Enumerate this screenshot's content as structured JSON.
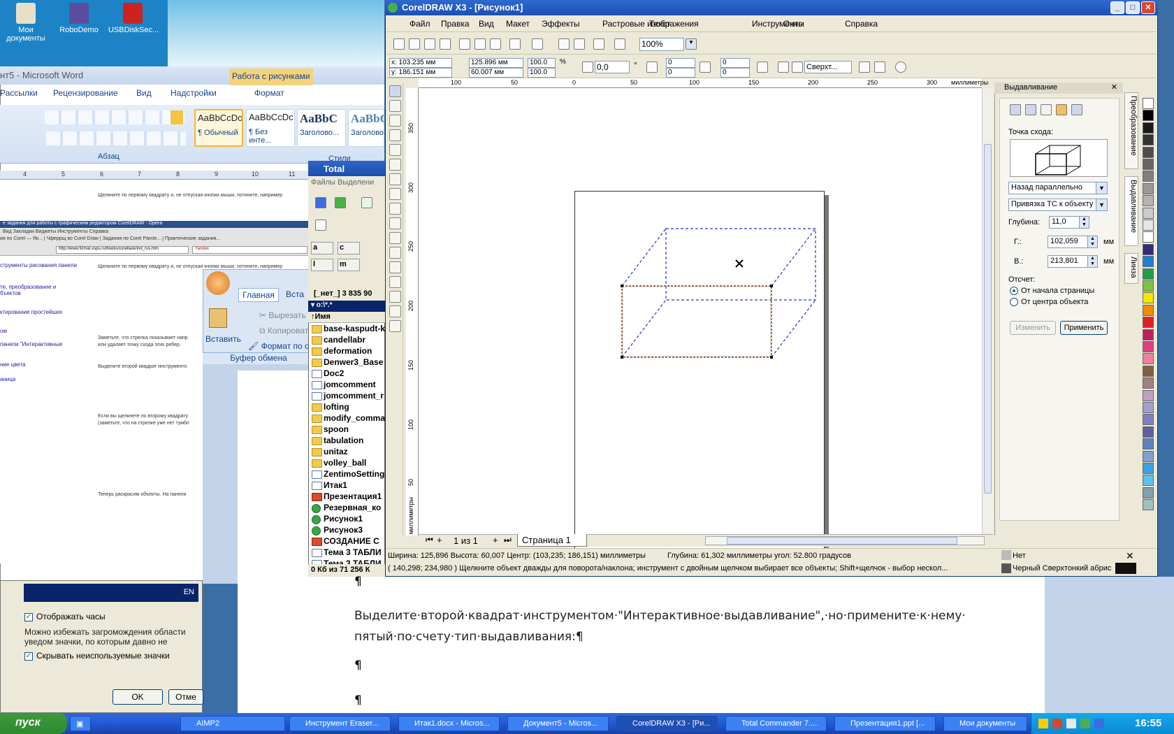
{
  "desktop": {
    "icons": [
      {
        "label": "Мои документы"
      },
      {
        "label": "RoboDemo"
      },
      {
        "label": "USBDiskSec..."
      }
    ]
  },
  "word": {
    "title": "нт5 - Microsoft Word",
    "context_tab": "Работа с рисунками",
    "tabs": [
      "Рассылки",
      "Рецензирование",
      "Вид",
      "Надстройки",
      "Формат"
    ],
    "groups": [
      "Абзац",
      "Стили"
    ],
    "styles": [
      {
        "preview": "AaBbCcDc",
        "name": "¶ Обычный"
      },
      {
        "preview": "AaBbCcDc",
        "name": "¶ Без инте..."
      },
      {
        "preview": "AaBbC",
        "name": "Заголово..."
      },
      {
        "preview": "AaBbC",
        "name": "Заголово"
      }
    ],
    "ruler_marks": [
      "4",
      "5",
      "6",
      "7",
      "8",
      "9",
      "10",
      "11"
    ],
    "inner_lines": [
      "Щелкните по первому квадрату и, не отпуская кнопки мыши, потяните, например",
      "Щелкните по первому квадрату и, не отпуская кнопки мыши, потяните, например",
      "Заметьте, что стрелка показывает напр",
      "или удаляет точку схода этих ребер.",
      "Выделите второй квадрат инструменто",
      "Если вы щелкнете по второму квадрату",
      "(заметьте, что на стрелке уже нет тумбл",
      "Теперь раскрасим объекты. На панели"
    ],
    "side_links": [
      "струменты рисования панели",
      "те, преобразование и",
      "бъектов",
      "ктирование простейших",
      "ом",
      "панели \"Интерактивные",
      "ние цвета",
      "аница"
    ],
    "opera_title": "е задания для работы с графическим редактором CorelDRAW - Opera",
    "opera_menu": [
      "Вид",
      "Закладки",
      "Виджеты",
      "Инструменты",
      "Справка"
    ],
    "opera_tabs": [
      "ия по Corel — Як...",
      "Чферрщ во Corel Draw",
      "Задания по Corel Painte...",
      "Практические задания..."
    ],
    "opera_url": "http://www.fizmat.vspu.ru/books/coreltask/ind_rus.htm",
    "opera_search": "Yandex"
  },
  "word2": {
    "tabs": [
      "Главная",
      "Вста"
    ],
    "cut": "Вырезать",
    "copy": "Копировать",
    "format": "Формат по об",
    "paste": "Вставить",
    "group": "Буфер обмена"
  },
  "dialog": {
    "lang": "EN",
    "show_clock": "Отображать часы",
    "info": "Можно избежать загромождения области уведом значки, по которым давно не выполнялись щелчи",
    "hide_unused": "Скрывать неиспользуемые значки",
    "ok": "OK",
    "cancel": "Отме"
  },
  "tc": {
    "title": "Total Comman",
    "menu": "Файлы  Выделени",
    "drives": [
      "a",
      "c",
      "l",
      "m"
    ],
    "info": "[_нет_]  3 835 90",
    "path": "▾ o:\\*.*",
    "header": "↑Имя",
    "files": [
      {
        "name": "base-kaspudt-k",
        "t": "d"
      },
      {
        "name": "candellabr",
        "t": "d"
      },
      {
        "name": "deformation",
        "t": "d"
      },
      {
        "name": "Denwer3_Base",
        "t": "d"
      },
      {
        "name": "Doc2",
        "t": "f"
      },
      {
        "name": "jomcomment",
        "t": "f"
      },
      {
        "name": "jomcomment_r",
        "t": "f"
      },
      {
        "name": "lofting",
        "t": "d"
      },
      {
        "name": "modify_comma",
        "t": "d"
      },
      {
        "name": "spoon",
        "t": "d"
      },
      {
        "name": "tabulation",
        "t": "d"
      },
      {
        "name": "unitaz",
        "t": "d"
      },
      {
        "name": "volley_ball",
        "t": "d"
      },
      {
        "name": "ZentimoSetting",
        "t": "f"
      },
      {
        "name": "Итак1",
        "t": "f"
      },
      {
        "name": "Презентация1",
        "t": "r"
      },
      {
        "name": "Резервная_ко",
        "t": "c"
      },
      {
        "name": "Рисунок1",
        "t": "c"
      },
      {
        "name": "Рисунок3",
        "t": "c"
      },
      {
        "name": "СОЗДАНИЕ С",
        "t": "r"
      },
      {
        "name": "Тема 3 ТАБЛИ",
        "t": "f"
      },
      {
        "name": "Тема 3 ТАБЛИ",
        "t": "f"
      }
    ],
    "footer": "0 Кб из 71 256 К"
  },
  "doc2": {
    "p1": "¶",
    "line1": "Выделите·второй·квадрат·инструментом·\"Интерактивное·выдавливание\",·но·примените·к·нему·",
    "line2": "пятый·по·счету·тип·выдавливания:¶",
    "p2": "¶",
    "p3": "¶"
  },
  "corel": {
    "title": "CorelDRAW X3 - [Рисунок1]",
    "menu": [
      "Файл",
      "Правка",
      "Вид",
      "Макет",
      "Эффекты",
      "Растровые изображения",
      "Текст",
      "Инструменты",
      "Окно",
      "Справка"
    ],
    "zoom": "100%",
    "x": "x: 103.235 мм",
    "y": "y: 186.151 мм",
    "w": "125.896 мм",
    "h": "60.007 мм",
    "scale_x": "100.0",
    "scale_y": "100.0",
    "pct": "%",
    "angle": "0,0",
    "deg": "°",
    "fields": [
      "0",
      "0",
      "0",
      "0"
    ],
    "outline": "Сверхт...",
    "hruler_label": "миллиметры",
    "hruler": [
      "100",
      "50",
      "0",
      "50",
      "100",
      "150",
      "200",
      "250",
      "300"
    ],
    "vruler": [
      "350",
      "300",
      "250",
      "200",
      "150",
      "100",
      "50"
    ],
    "vruler_label": "миллиметры",
    "page_count": "1 из 1",
    "page_tab": "Страница 1",
    "status1": "Ширина: 125,896  Высота: 60,007  Центр: (103,235; 186,151)  миллиметры",
    "status1b": "Глубина: 61,302 миллиметры угол: 52.800 градусов",
    "status_fill": "Нет",
    "status2": "( 140,298; 234,980 )     Щелкните объект дважды для поворота/наклона; инструмент с двойным щелчком выбирает все объекты; Shift+щелчок - выбор нескол...",
    "status_outline": "Черный  Сверхтонкий абрис",
    "docker": {
      "title": "Выдавливание",
      "vp_label": "Точка схода:",
      "vp_type": "Назад параллельно",
      "snap": "Привязка ТС к объекту",
      "depth_label": "Глубина:",
      "depth": "11,0",
      "h_label": "Г.:",
      "h": "102,059",
      "unit": "мм",
      "v_label": "В.:",
      "v": "213,801",
      "ref_label": "Отсчет:",
      "ref_page": "От начала страницы",
      "ref_obj": "От центра объекта",
      "edit": "Изменить",
      "apply": "Применить"
    },
    "vtabs": [
      "Преобразование",
      "Выдавливание",
      "Линза"
    ]
  },
  "taskbar": {
    "start": "пуск",
    "items": [
      {
        "label": "AIMP2"
      },
      {
        "label": "Инструмент Eraser..."
      },
      {
        "label": "Итак1.docx - Micros..."
      },
      {
        "label": "Документ5 - Micros..."
      },
      {
        "label": "CorelDRAW X3 - [Ри..."
      },
      {
        "label": "Total Commander 7...."
      },
      {
        "label": "Презентация1.ppt [..."
      },
      {
        "label": "Мои документы"
      }
    ],
    "clock": "16:55"
  },
  "colors": {
    "corel_title": "#1c4fb5",
    "selection": "#c8102e",
    "extrude": "#2233cc",
    "taskbar": "#245edb",
    "start": "#2f8a2f"
  }
}
